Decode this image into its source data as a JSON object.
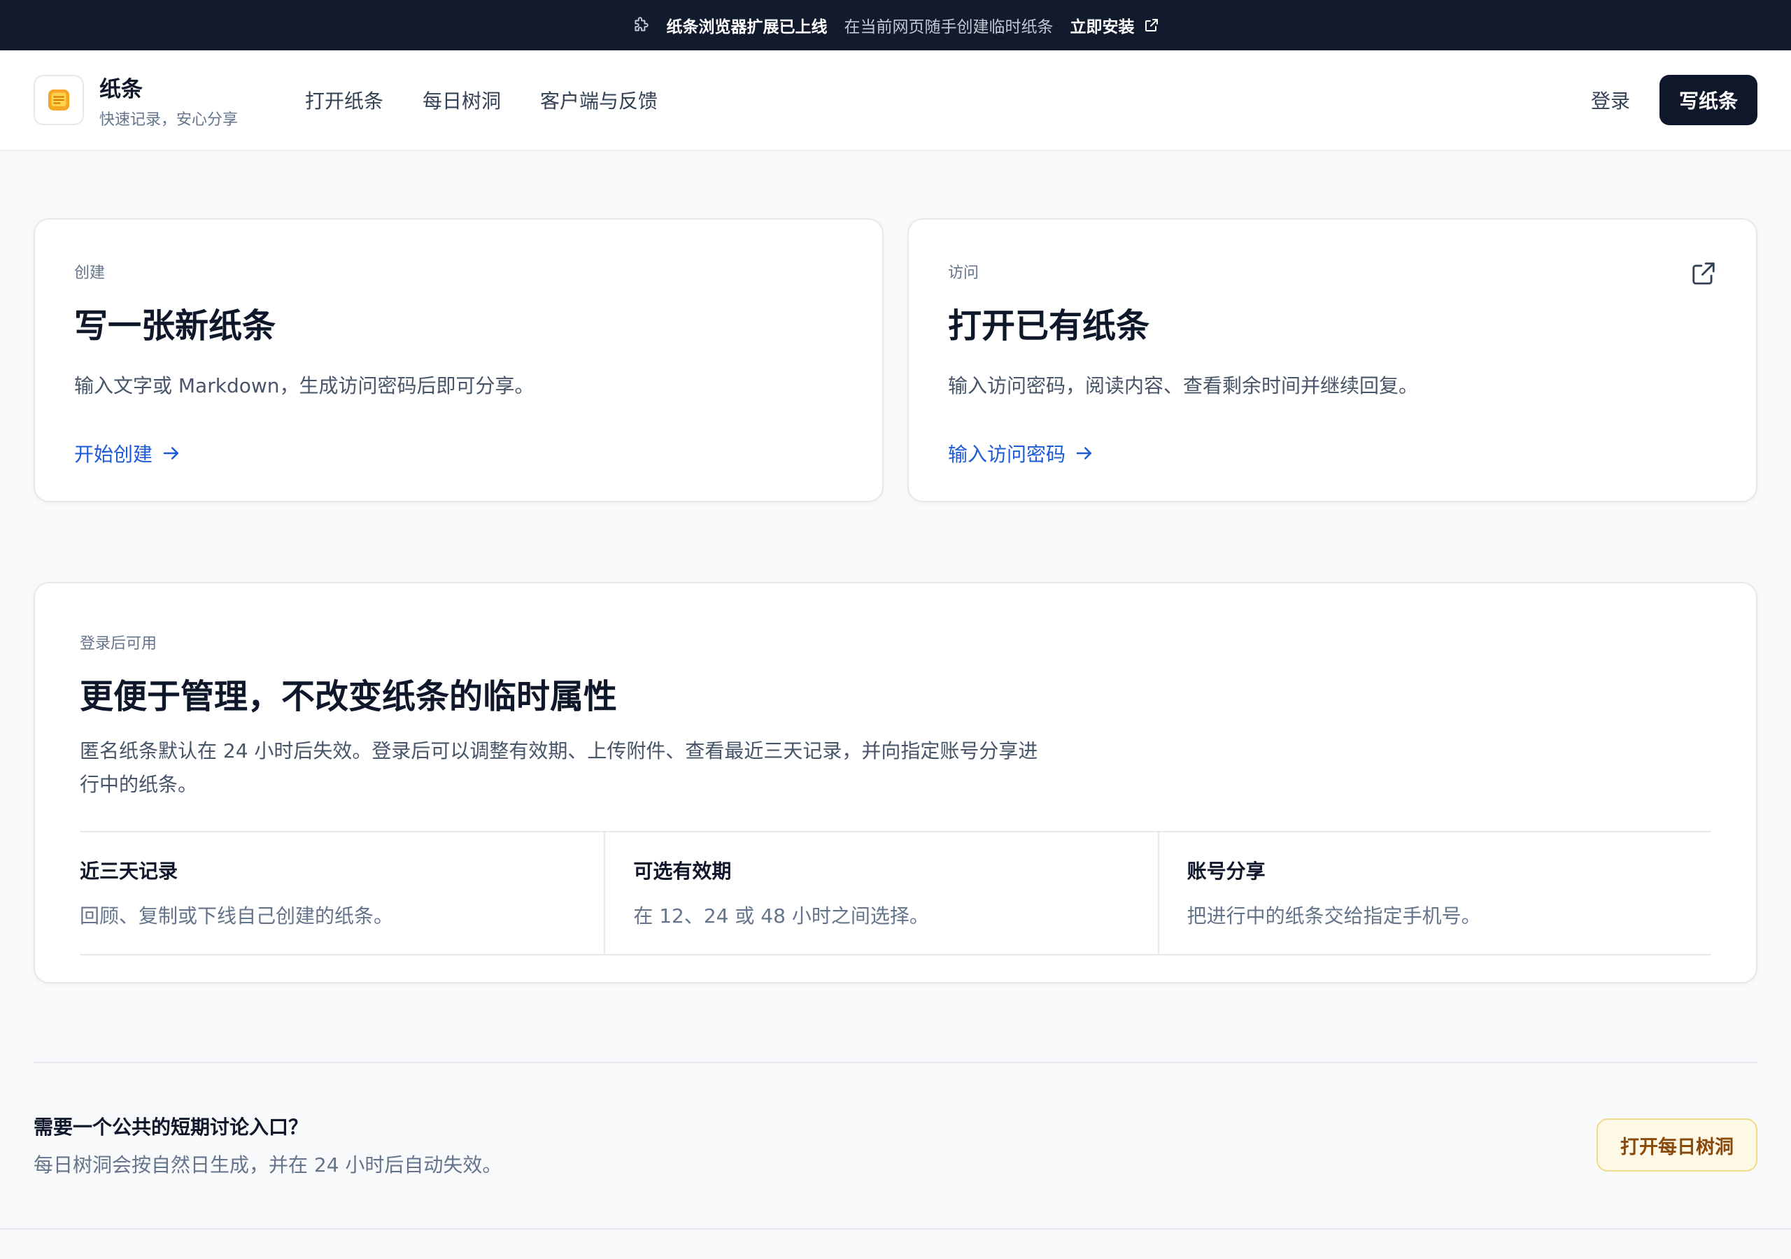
{
  "banner": {
    "icon": "puzzle-icon",
    "title": "纸条浏览器扩展已上线",
    "description": "在当前网页随手创建临时纸条",
    "install_label": "立即安装"
  },
  "header": {
    "brand_name": "纸条",
    "brand_slogan": "快速记录，安心分享",
    "nav": [
      "打开纸条",
      "每日树洞",
      "客户端与反馈"
    ],
    "login_label": "登录",
    "write_label": "写纸条"
  },
  "cards": [
    {
      "eyebrow": "创建",
      "title": "写一张新纸条",
      "description": "输入文字或 Markdown，生成访问密码后即可分享。",
      "link_label": "开始创建"
    },
    {
      "eyebrow": "访问",
      "title": "打开已有纸条",
      "description": "输入访问密码，阅读内容、查看剩余时间并继续回复。",
      "link_label": "输入访问密码"
    }
  ],
  "panel": {
    "eyebrow": "登录后可用",
    "title": "更便于管理，不改变纸条的临时属性",
    "description": "匿名纸条默认在 24 小时后失效。登录后可以调整有效期、上传附件、查看最近三天记录，并向指定账号分享进行中的纸条。",
    "features": [
      {
        "title": "近三天记录",
        "description": "回顾、复制或下线自己创建的纸条。"
      },
      {
        "title": "可选有效期",
        "description": "在 12、24 或 48 小时之间选择。"
      },
      {
        "title": "账号分享",
        "description": "把进行中的纸条交给指定手机号。"
      }
    ]
  },
  "cta": {
    "question": "需要一个公共的短期讨论入口？",
    "answer": "每日树洞会按自然日生成，并在 24 小时后自动失效。",
    "button_label": "打开每日树洞"
  },
  "colors": {
    "banner_bg": "#121a2e",
    "primary": "#0f172a",
    "link": "#1d5bd6",
    "cta_bg": "#fef9e7",
    "cta_text": "#8a4a0c",
    "logo_accent": "#f5a623"
  }
}
